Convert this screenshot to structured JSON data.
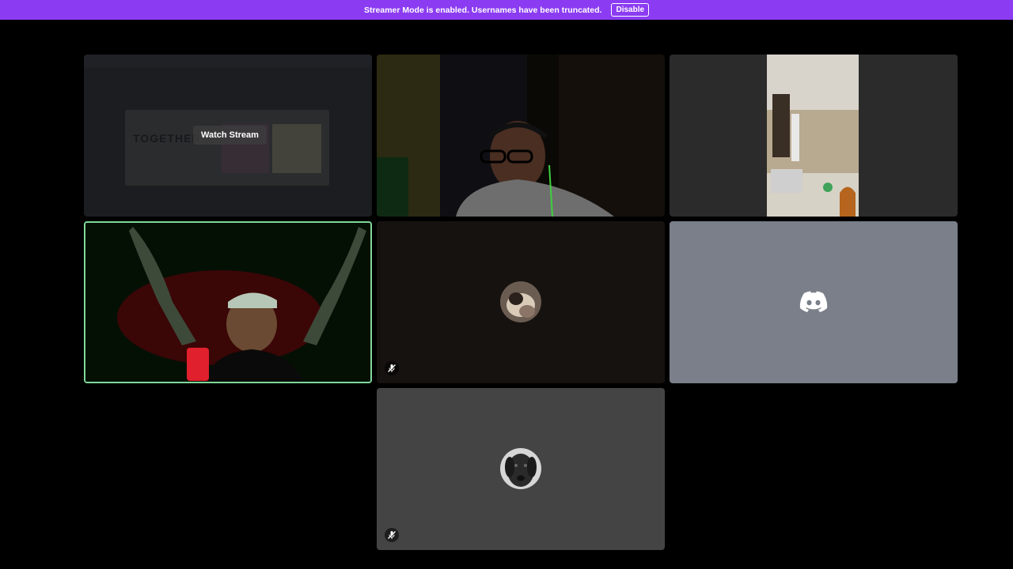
{
  "banner": {
    "text": "Streamer Mode is enabled. Usernames have been truncated.",
    "disable_label": "Disable"
  },
  "tiles": [
    {
      "type": "stream",
      "watch_label": "Watch Stream",
      "preview_text": "TOGETHER"
    },
    {
      "type": "video"
    },
    {
      "type": "video"
    },
    {
      "type": "video",
      "speaking": true
    },
    {
      "type": "avatar",
      "muted": true
    },
    {
      "type": "avatar-default"
    },
    {
      "type": "avatar",
      "muted": true
    }
  ],
  "colors": {
    "banner_bg": "#8b3cf2",
    "speaking_border": "#7fd99a",
    "default_avatar_bg": "#7a7f8a",
    "background": "#000000"
  }
}
